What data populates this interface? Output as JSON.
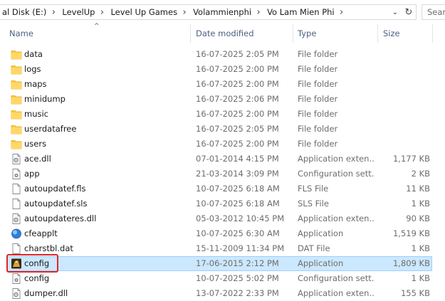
{
  "address_bar": {
    "crumbs": [
      "al Disk (E:)",
      "LevelUp",
      "Level Up Games",
      "Volammienphi",
      "Vo Lam Mien Phi"
    ],
    "separator": "›",
    "dropdown_glyph": "⌄",
    "refresh_glyph": "↻"
  },
  "search": {
    "placeholder": "Sear"
  },
  "columns": {
    "name": "Name",
    "date": "Date modified",
    "type": "Type",
    "size": "Size"
  },
  "sort_indicator": "^",
  "rows": [
    {
      "name": "data",
      "date": "16-07-2025 2:05 PM",
      "type": "File folder",
      "size": "",
      "icon": "folder-icon"
    },
    {
      "name": "logs",
      "date": "16-07-2025 2:00 PM",
      "type": "File folder",
      "size": "",
      "icon": "folder-icon"
    },
    {
      "name": "maps",
      "date": "16-07-2025 2:00 PM",
      "type": "File folder",
      "size": "",
      "icon": "folder-icon"
    },
    {
      "name": "minidump",
      "date": "16-07-2025 2:06 PM",
      "type": "File folder",
      "size": "",
      "icon": "folder-icon"
    },
    {
      "name": "music",
      "date": "16-07-2025 2:00 PM",
      "type": "File folder",
      "size": "",
      "icon": "folder-icon"
    },
    {
      "name": "userdatafree",
      "date": "16-07-2025 2:05 PM",
      "type": "File folder",
      "size": "",
      "icon": "folder-icon"
    },
    {
      "name": "users",
      "date": "16-07-2025 2:00 PM",
      "type": "File folder",
      "size": "",
      "icon": "folder-icon"
    },
    {
      "name": "ace.dll",
      "date": "07-01-2014 4:15 PM",
      "type": "Application exten...",
      "size": "1,177 KB",
      "icon": "dll-file-icon"
    },
    {
      "name": "app",
      "date": "21-03-2014 3:09 PM",
      "type": "Configuration sett...",
      "size": "2 KB",
      "icon": "config-file-icon"
    },
    {
      "name": "autoupdatef.fls",
      "date": "10-07-2025 6:18 AM",
      "type": "FLS File",
      "size": "11 KB",
      "icon": "blank-file-icon"
    },
    {
      "name": "autoupdatef.sls",
      "date": "10-07-2025 6:18 AM",
      "type": "SLS File",
      "size": "1 KB",
      "icon": "blank-file-icon"
    },
    {
      "name": "autoupdateres.dll",
      "date": "05-03-2012 10:45 PM",
      "type": "Application exten...",
      "size": "90 KB",
      "icon": "dll-file-icon"
    },
    {
      "name": "cfeapplt",
      "date": "10-07-2025 6:30 AM",
      "type": "Application",
      "size": "1,519 KB",
      "icon": "globe-app-icon"
    },
    {
      "name": "charstbl.dat",
      "date": "15-11-2009 11:34 PM",
      "type": "DAT File",
      "size": "1 KB",
      "icon": "blank-file-icon"
    },
    {
      "name": "config",
      "date": "17-06-2015 2:12 PM",
      "type": "Application",
      "size": "1,809 KB",
      "icon": "game-app-icon",
      "selected": true
    },
    {
      "name": "config",
      "date": "10-07-2025 5:02 PM",
      "type": "Configuration sett...",
      "size": "1 KB",
      "icon": "config-file-icon"
    },
    {
      "name": "dumper.dll",
      "date": "13-07-2022 2:33 PM",
      "type": "Application exten...",
      "size": "155 KB",
      "icon": "dll-file-icon"
    }
  ],
  "colors": {
    "selection_bg": "#cce8ff",
    "selection_border": "#99d1ff",
    "highlight_box": "#e0252a",
    "folder": "#ffc83d",
    "header_text": "#4d6082"
  }
}
